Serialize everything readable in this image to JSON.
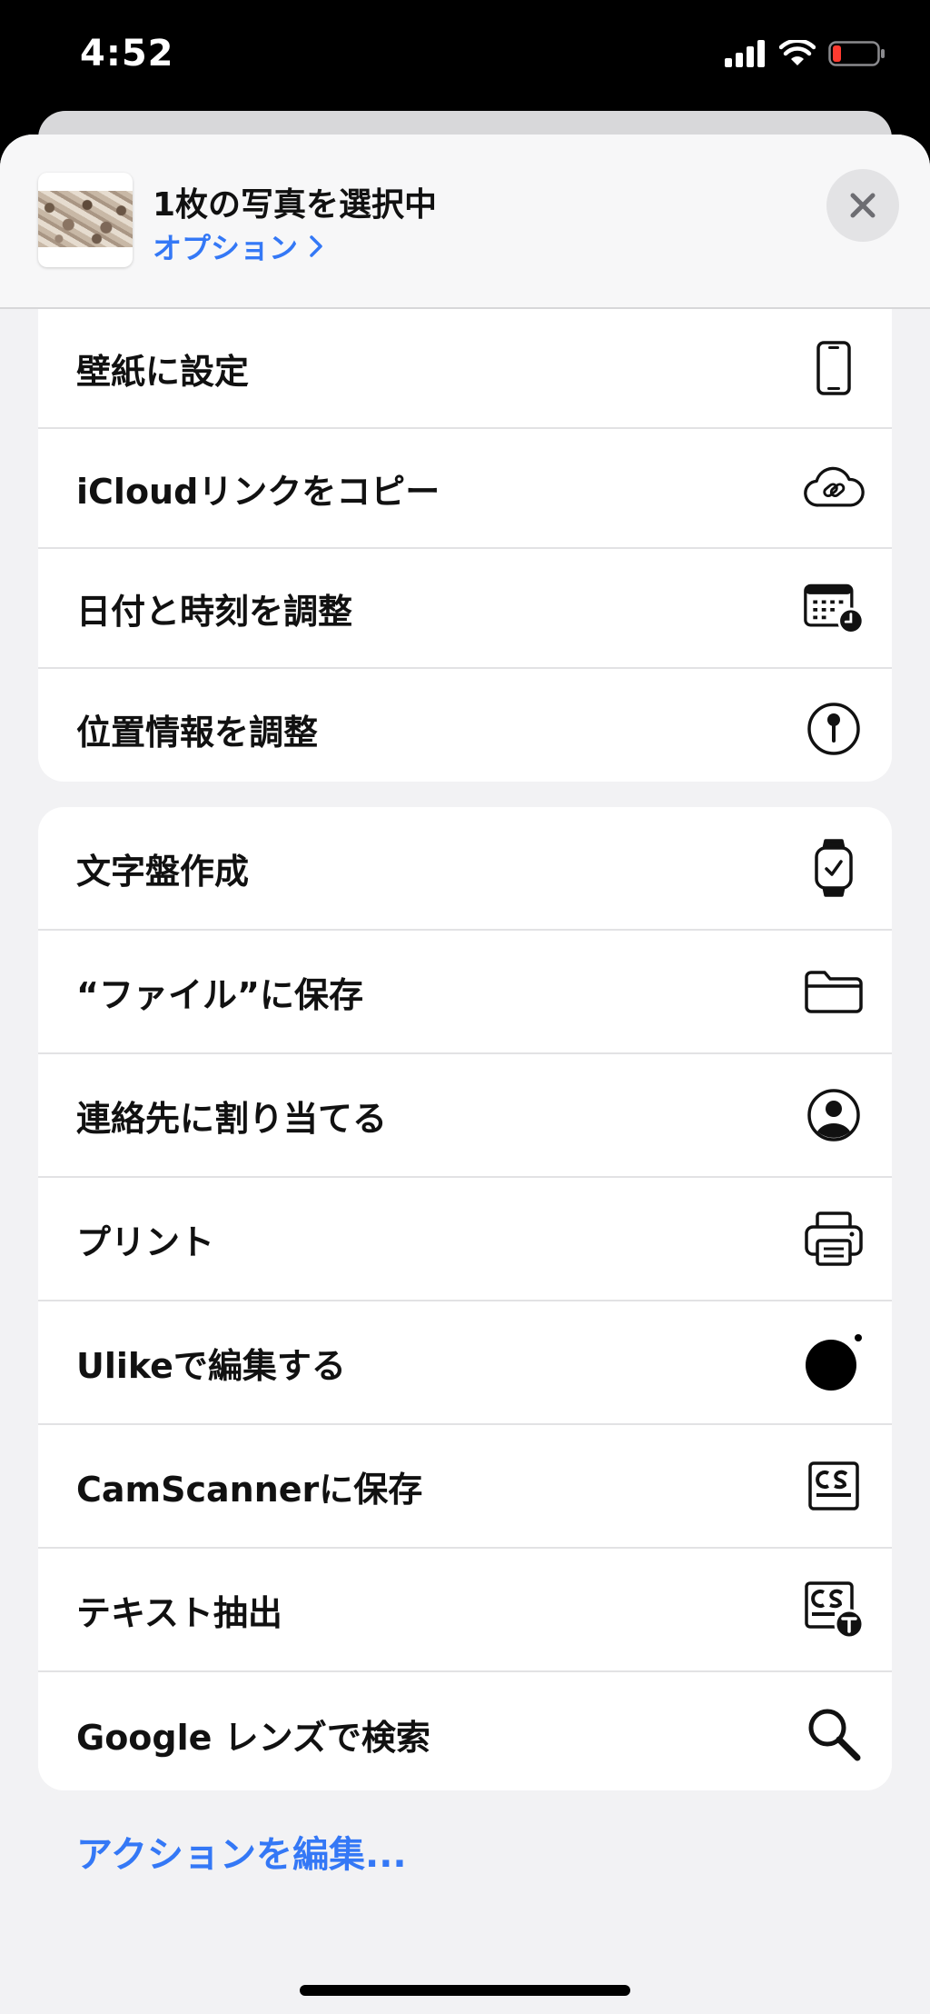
{
  "status_bar": {
    "time": "4:52",
    "icons": [
      "signal-icon",
      "wifi-icon",
      "battery-low-icon"
    ]
  },
  "header": {
    "title": "1枚の写真を選択中",
    "options_label": "オプション",
    "options_icon": "chevron-right-icon",
    "close_icon": "close-icon"
  },
  "actions_group_1": [
    {
      "label": "壁紙に設定",
      "icon": "phone-icon"
    },
    {
      "label": "iCloudリンクをコピー",
      "icon": "cloud-link-icon"
    },
    {
      "label": "日付と時刻を調整",
      "icon": "calendar-clock-icon"
    },
    {
      "label": "位置情報を調整",
      "icon": "location-pin-icon"
    }
  ],
  "actions_group_2": [
    {
      "label": "文字盤作成",
      "icon": "watch-icon"
    },
    {
      "label": "“ファイル”に保存",
      "icon": "folder-icon"
    },
    {
      "label": "連絡先に割り当てる",
      "icon": "person-circle-icon"
    },
    {
      "label": "プリント",
      "icon": "printer-icon"
    },
    {
      "label": "Ulikeで編集する",
      "icon": "ulike-icon"
    },
    {
      "label": "CamScannerに保存",
      "icon": "camscanner-icon"
    },
    {
      "label": "テキスト抽出",
      "icon": "camscanner-text-icon"
    },
    {
      "label": "Google レンズで検索",
      "icon": "magnifier-icon"
    }
  ],
  "edit_actions_label": "アクションを編集...",
  "colors": {
    "accent": "#3478f6",
    "sheet_background": "#f2f2f4",
    "row_background": "#ffffff"
  }
}
